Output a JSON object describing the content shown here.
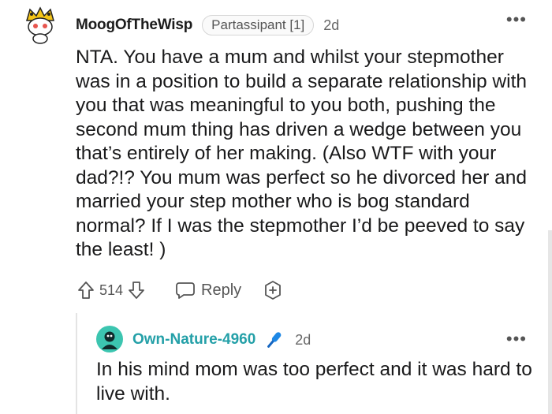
{
  "comment": {
    "avatar_icon": "snoo-avatar-icon",
    "username": "MoogOfTheWisp",
    "flair": "Partassipant [1]",
    "time": "2d",
    "more_icon": "more-options-icon",
    "body": "NTA. You have a mum and whilst your stepmother was in a position to build a separate relationship with you that was meaningful to you both, pushing the second mum thing has driven a wedge between you that’s entirely of her making. (Also WTF with your dad?!? You mum was perfect so he divorced her and married your step mother who is bog standard normal? If I was the stepmother I’d be peeved to say the least! )",
    "score": "514",
    "reply_label": "Reply"
  },
  "reply": {
    "avatar_icon": "teal-avatar-icon",
    "username": "Own-Nature-4960",
    "badge_icon": "microphone-icon",
    "time": "2d",
    "body": "In his mind mom was too perfect and it was hard to live with."
  },
  "colors": {
    "reply_username": "#24a0a8",
    "badge": "#1e88e5",
    "avatar_accent": "#f5c518"
  }
}
